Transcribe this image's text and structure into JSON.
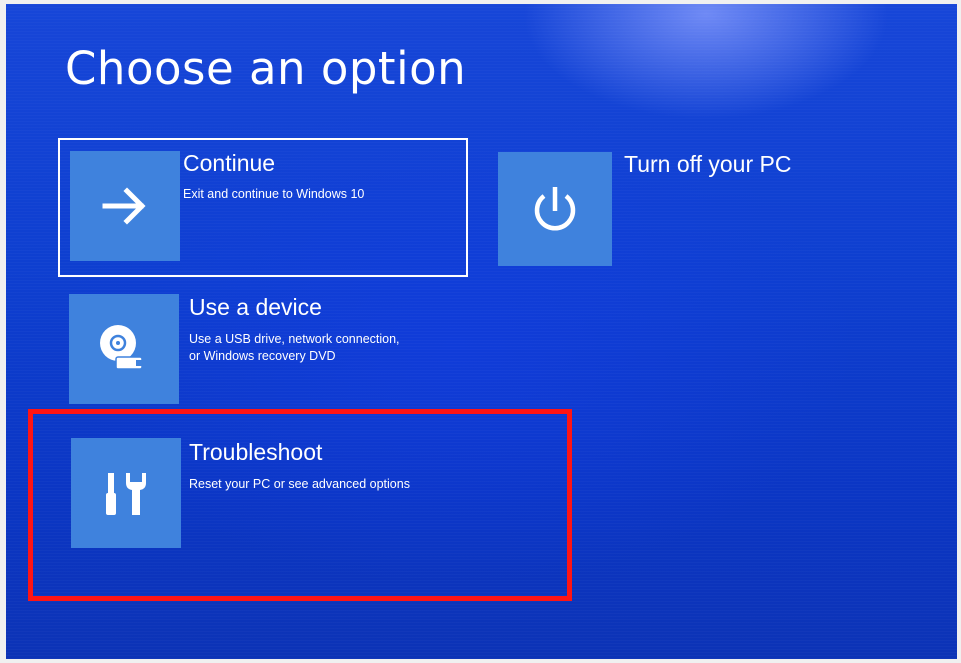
{
  "title": "Choose an option",
  "options": [
    {
      "id": "continue",
      "label": "Continue",
      "description": "Exit and continue to Windows 10",
      "icon": "arrow-right-icon",
      "selected": true
    },
    {
      "id": "turn-off",
      "label": "Turn off your PC",
      "description": "",
      "icon": "power-icon",
      "selected": false
    },
    {
      "id": "use-device",
      "label": "Use a device",
      "description": "Use a USB drive, network connection,\nor Windows recovery DVD",
      "icon": "disc-drive-icon",
      "selected": false
    },
    {
      "id": "troubleshoot",
      "label": "Troubleshoot",
      "description": "Reset your PC or see advanced options",
      "icon": "tools-icon",
      "selected": false,
      "highlighted": true
    }
  ],
  "colors": {
    "background": "#0e3fd0",
    "tile": "#3f82dd",
    "text": "#ffffff",
    "highlight": "#ff1414"
  }
}
